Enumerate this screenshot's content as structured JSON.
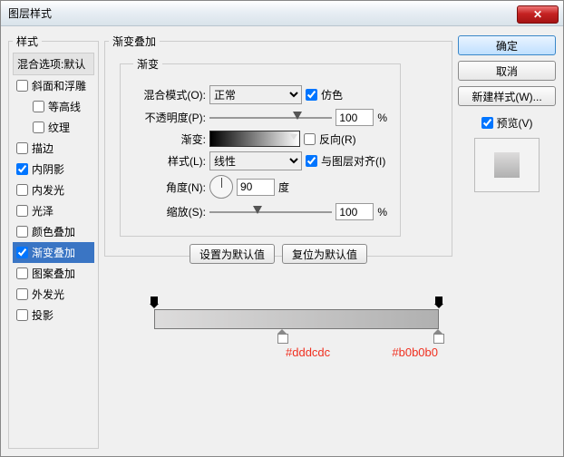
{
  "window": {
    "title": "图层样式"
  },
  "sidebar": {
    "legend": "样式",
    "header": "混合选项:默认",
    "items": [
      {
        "label": "斜面和浮雕",
        "checked": false,
        "indent": false
      },
      {
        "label": "等高线",
        "checked": false,
        "indent": true
      },
      {
        "label": "纹理",
        "checked": false,
        "indent": true
      },
      {
        "label": "描边",
        "checked": false,
        "indent": false
      },
      {
        "label": "内阴影",
        "checked": true,
        "indent": false
      },
      {
        "label": "内发光",
        "checked": false,
        "indent": false
      },
      {
        "label": "光泽",
        "checked": false,
        "indent": false
      },
      {
        "label": "颜色叠加",
        "checked": false,
        "indent": false
      },
      {
        "label": "渐变叠加",
        "checked": true,
        "indent": false,
        "selected": true
      },
      {
        "label": "图案叠加",
        "checked": false,
        "indent": false
      },
      {
        "label": "外发光",
        "checked": false,
        "indent": false
      },
      {
        "label": "投影",
        "checked": false,
        "indent": false
      }
    ]
  },
  "panel": {
    "group_legend": "渐变叠加",
    "inner_legend": "渐变",
    "blend_label": "混合模式(O):",
    "blend_value": "正常",
    "dither_label": "仿色",
    "opacity_label": "不透明度(P):",
    "opacity_value": "100",
    "pct": "%",
    "gradient_label": "渐变:",
    "reverse_label": "反向(R)",
    "style_label": "样式(L):",
    "style_value": "线性",
    "align_label": "与图层对齐(I)",
    "angle_label": "角度(N):",
    "angle_value": "90",
    "angle_unit": "度",
    "scale_label": "缩放(S):",
    "scale_value": "100",
    "btn_default": "设置为默认值",
    "btn_reset": "复位为默认值"
  },
  "right": {
    "ok": "确定",
    "cancel": "取消",
    "newstyle": "新建样式(W)...",
    "preview": "预览(V)"
  },
  "gradient_bar": {
    "stop1": "#dddcdc",
    "stop2": "#b0b0b0"
  }
}
